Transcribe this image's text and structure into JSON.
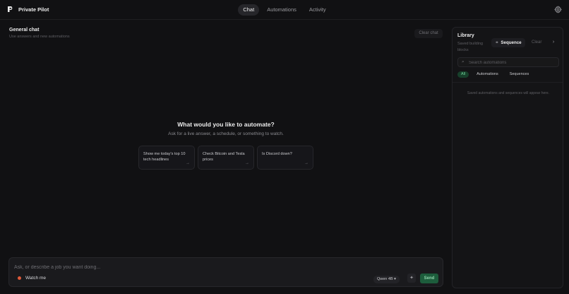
{
  "app": {
    "name": "Private Pilot"
  },
  "nav": {
    "tabs": [
      "Chat",
      "Automations",
      "Activity"
    ],
    "active": "Chat"
  },
  "chat": {
    "title": "General chat",
    "subtitle": "Use answers and new automations",
    "clear_label": "Clear chat",
    "empty_title": "What would you like to automate?",
    "empty_subtitle": "Ask for a live answer, a schedule, or something to watch.",
    "suggestions": [
      "Show me today's top 10 tech headlines",
      "Check Bitcoin and Tesla prices",
      "Is Discord down?"
    ],
    "arrow": "→"
  },
  "composer": {
    "placeholder": "Ask, or describe a job you want doing...",
    "watch_label": "Watch me",
    "model": "Qwen 4B ▾",
    "mic_icon": "✦",
    "send_label": "Send"
  },
  "library": {
    "title": "Library",
    "subtitle": "Saved building blocks",
    "sequence_label": "Sequence",
    "clear_label": "Clear",
    "next_icon": "›",
    "search_placeholder": "Search automations",
    "filters": [
      "All",
      "Automations",
      "Sequences"
    ],
    "active_filter": "All",
    "empty_text": "Saved automations and sequences will appear here."
  },
  "colors": {
    "accent": "#1d5d3c",
    "accent_text": "#6fcf97",
    "record": "#e05a3a"
  }
}
